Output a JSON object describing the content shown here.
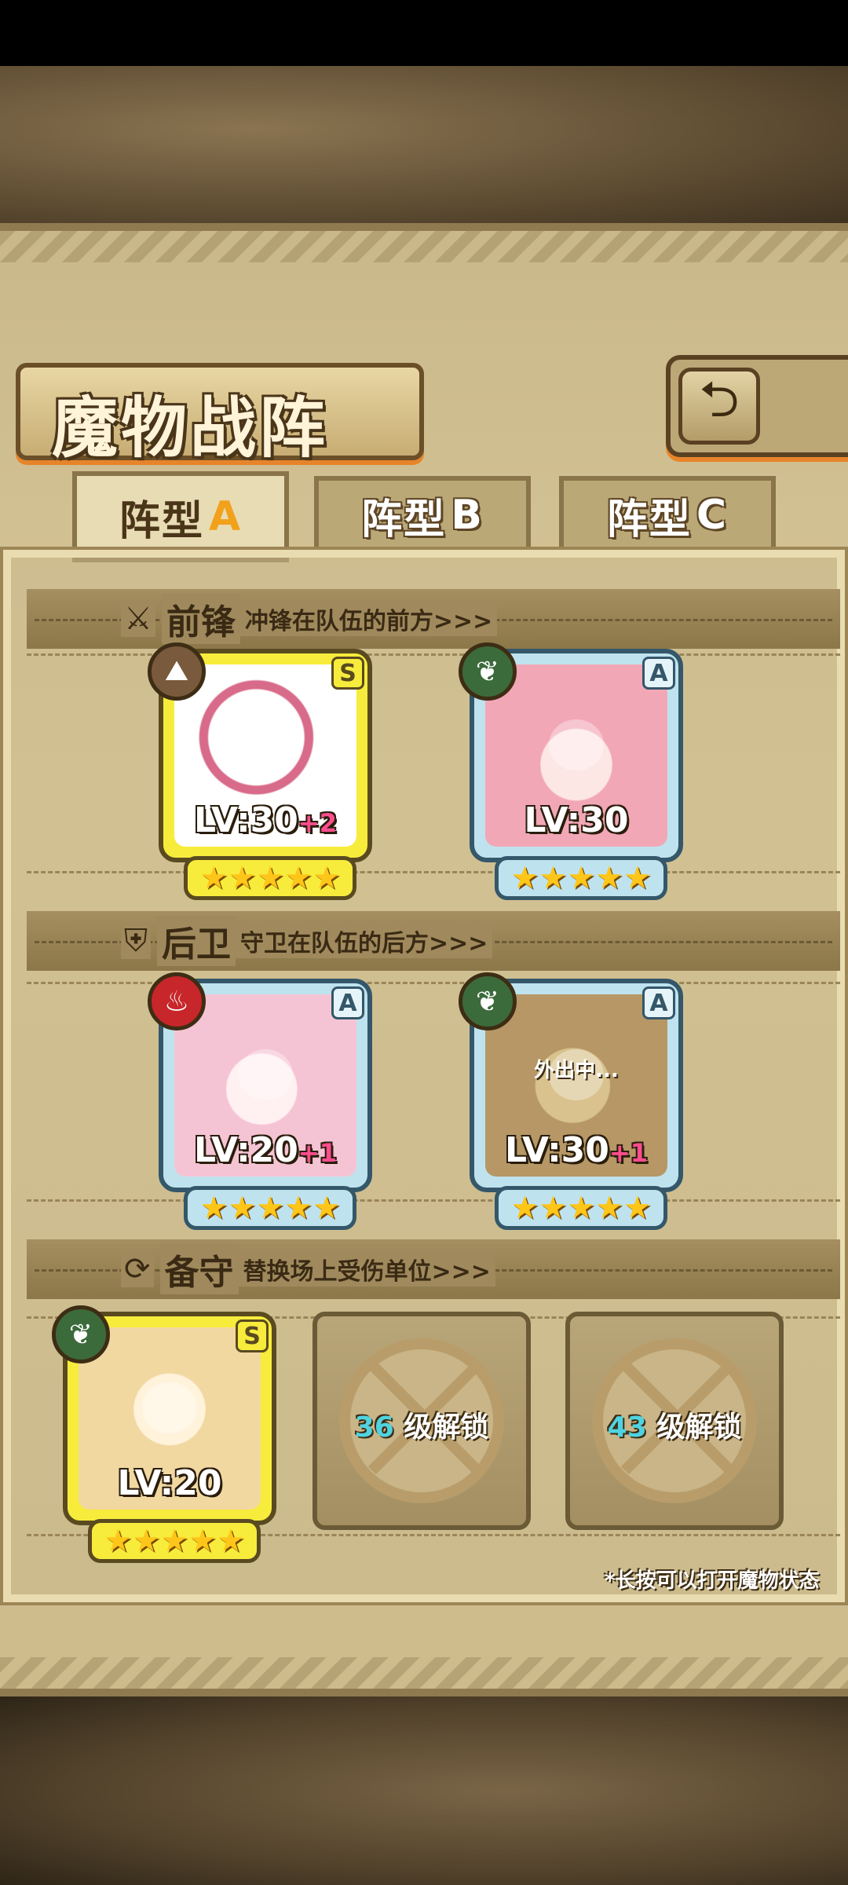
{
  "title": "魔物战阵",
  "back_icon": "back-arrow-icon",
  "tabs": [
    {
      "label": "阵型",
      "letter": "A",
      "active": true
    },
    {
      "label": "阵型",
      "letter": "B",
      "active": false
    },
    {
      "label": "阵型",
      "letter": "C",
      "active": false
    }
  ],
  "sections": {
    "vanguard": {
      "title": "前锋",
      "subtitle": "冲锋在队伍的前方>>>",
      "icon": "sword-icon"
    },
    "rearguard": {
      "title": "后卫",
      "subtitle": "守卫在队伍的后方>>>",
      "icon": "shield-icon"
    },
    "reserve": {
      "title": "备守",
      "subtitle": "替换场上受伤单位>>>",
      "icon": "swap-icon"
    }
  },
  "units": {
    "v1": {
      "rank": "S",
      "element": "earth",
      "level_label": "LV:30",
      "plus": "+2",
      "stars": "★★★★★"
    },
    "v2": {
      "rank": "A",
      "element": "leaf",
      "level_label": "LV:30",
      "plus": "",
      "stars": "★★★★★"
    },
    "r1": {
      "rank": "A",
      "element": "fire",
      "level_label": "LV:20",
      "plus": "+1",
      "stars": "★★★★★"
    },
    "r2": {
      "rank": "A",
      "element": "leaf",
      "level_label": "LV:30",
      "plus": "+1",
      "stars": "★★★★★",
      "status": "外出中..."
    },
    "b1": {
      "rank": "S",
      "element": "leaf",
      "level_label": "LV:20",
      "plus": "",
      "stars": "★★★★★"
    }
  },
  "locked_slots": [
    {
      "level": "36",
      "label": "级解锁"
    },
    {
      "level": "43",
      "label": "级解锁"
    }
  ],
  "hint": "*长按可以打开魔物状态"
}
